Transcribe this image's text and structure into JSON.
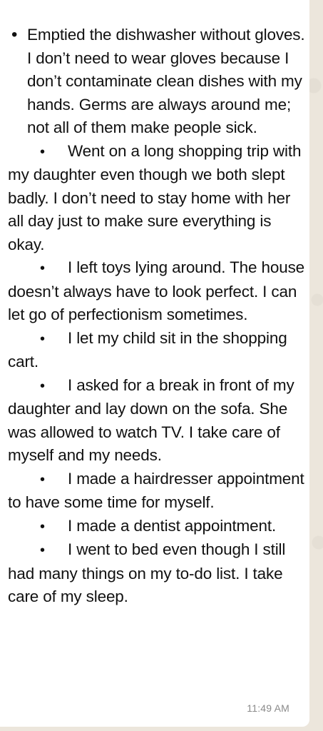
{
  "message": {
    "first_item": "Emptied the dishwasher without gloves. I don’t need to wear gloves because I don’t contaminate clean dishes with my hands. Germs are always around me; not all of them make people sick.",
    "items": [
      "Went on a long shopping trip with my daughter even though we both slept badly. I don’t need to stay home with her all day just to make sure everything is okay.",
      "I left toys lying around. The house doesn’t always have to look perfect. I can let go of perfectionism sometimes.",
      "I let my child sit in the shopping cart.",
      "I asked for a break in front of my daughter and lay down on the sofa. She was allowed to watch TV. I take care of myself and my needs.",
      "I made a hairdresser appointment to have some time for myself.",
      "I made a dentist appointment.",
      "I went to bed even though I still had many things on my to-do list. I take care of my sleep."
    ],
    "timestamp": "11:49 AM"
  },
  "icons": {
    "bullet": "•"
  },
  "colors": {
    "background": "#ece6dc",
    "bubble": "#ffffff",
    "text": "#111111",
    "timestamp": "#8a8a8a"
  }
}
